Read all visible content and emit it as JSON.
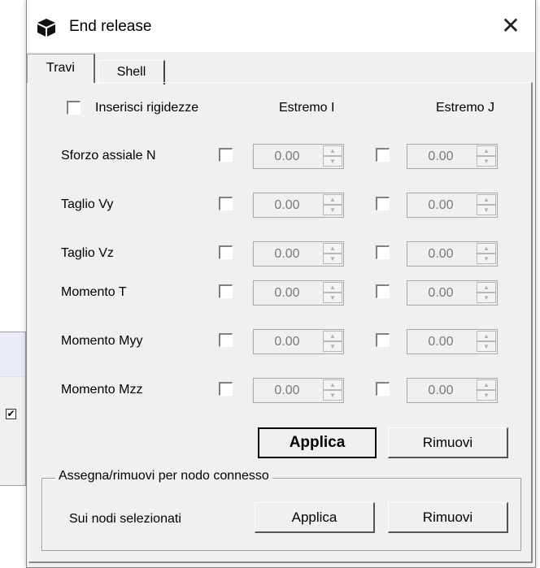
{
  "window": {
    "title": "End release"
  },
  "tabs": [
    {
      "label": "Travi"
    },
    {
      "label": "Shell"
    }
  ],
  "top": {
    "inserisci_label": "Inserisci rigidezze",
    "estremo_i": "Estremo I",
    "estremo_j": "Estremo J"
  },
  "rows": [
    {
      "label": "Sforzo assiale N",
      "i_value": "0.00",
      "j_value": "0.00"
    },
    {
      "label": "Taglio Vy",
      "i_value": "0.00",
      "j_value": "0.00"
    },
    {
      "label": "Taglio Vz",
      "i_value": "0.00",
      "j_value": "0.00"
    },
    {
      "label": "Momento T",
      "i_value": "0.00",
      "j_value": "0.00"
    },
    {
      "label": "Momento Myy",
      "i_value": "0.00",
      "j_value": "0.00"
    },
    {
      "label": "Momento Mzz",
      "i_value": "0.00",
      "j_value": "0.00"
    }
  ],
  "buttons": {
    "applica": "Applica",
    "rimuovi": "Rimuovi"
  },
  "group": {
    "legend": "Assegna/rimuovi per nodo connesso",
    "sui_nodi": "Sui nodi selezionati",
    "applica": "Applica",
    "rimuovi": "Rimuovi"
  },
  "background_window": {
    "checkbox_checked": true,
    "check_glyph": "✔"
  },
  "icons": {
    "app": "cube-icon",
    "close": "close-icon"
  }
}
